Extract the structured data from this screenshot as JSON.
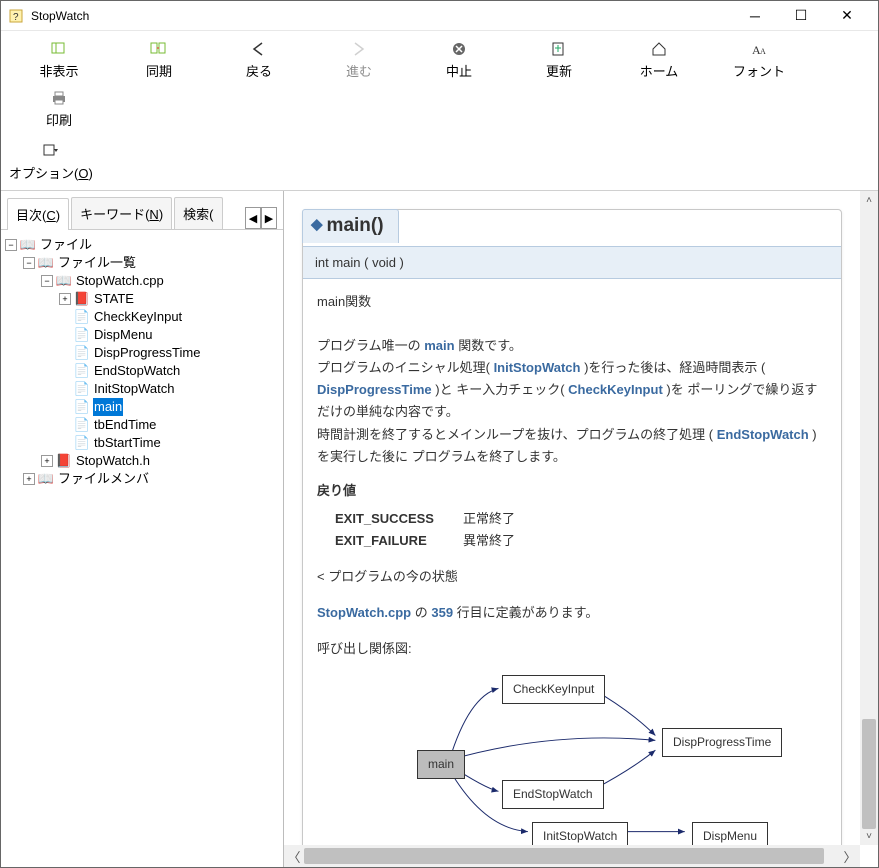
{
  "window": {
    "title": "StopWatch"
  },
  "toolbar": [
    {
      "id": "hide",
      "label": "非表示"
    },
    {
      "id": "sync",
      "label": "同期"
    },
    {
      "id": "back",
      "label": "戻る"
    },
    {
      "id": "forward",
      "label": "進む",
      "disabled": true
    },
    {
      "id": "stop",
      "label": "中止"
    },
    {
      "id": "refresh",
      "label": "更新"
    },
    {
      "id": "home",
      "label": "ホーム"
    },
    {
      "id": "font",
      "label": "フォント"
    },
    {
      "id": "print",
      "label": "印刷"
    }
  ],
  "toolbar2": {
    "options": {
      "label": "オプション(",
      "ul": "O",
      "after": ")"
    }
  },
  "tabs": [
    {
      "label": "目次(",
      "ul": "C",
      "after": ")",
      "active": true
    },
    {
      "label": "キーワード(",
      "ul": "N",
      "after": ")"
    },
    {
      "label": "検索(",
      "ul": "",
      "after": ""
    }
  ],
  "tree": {
    "file": "ファイル",
    "file_list": "ファイル一覧",
    "stopwatch_cpp": "StopWatch.cpp",
    "state": "STATE",
    "items": [
      "CheckKeyInput",
      "DispMenu",
      "DispProgressTime",
      "EndStopWatch",
      "InitStopWatch",
      "main",
      "tbEndTime",
      "tbStartTime"
    ],
    "stopwatch_h": "StopWatch.h",
    "file_member": "ファイルメンバ"
  },
  "doc": {
    "title": "main()",
    "signature": "int main ( void   )",
    "p1": "main関数",
    "p2a": "プログラム唯一の ",
    "p2link": "main",
    "p2b": " 関数です。",
    "p3a": "プログラムのイニシャル処理( ",
    "p3link1": "InitStopWatch",
    "p3b": " )を行った後は、経過時間表示 ( ",
    "p3link2": "DispProgressTime",
    "p3c": " )と キー入力チェック( ",
    "p3link3": "CheckKeyInput",
    "p3d": " )を ポーリングで繰り返すだけの単純な内容です。",
    "p4a": "時間計測を終了するとメインループを抜け、プログラムの終了処理 ( ",
    "p4link": "EndStopWatch",
    "p4b": " )を実行した後に プログラムを終了します。",
    "ret_heading": "戻り値",
    "ret1_key": "EXIT_SUCCESS",
    "ret1_val": "正常終了",
    "ret2_key": "EXIT_FAILURE",
    "ret2_val": "異常終了",
    "state_line": "< プログラムの今の状態",
    "defline_a": "StopWatch.cpp",
    "defline_b": " の ",
    "defline_num": "359",
    "defline_c": " 行目に定義があります。",
    "graph_heading": "呼び出し関係図:",
    "nodes": {
      "main": "main",
      "ck": "CheckKeyInput",
      "dpt": "DispProgressTime",
      "esw": "EndStopWatch",
      "isw": "InitStopWatch",
      "dm": "DispMenu"
    }
  }
}
